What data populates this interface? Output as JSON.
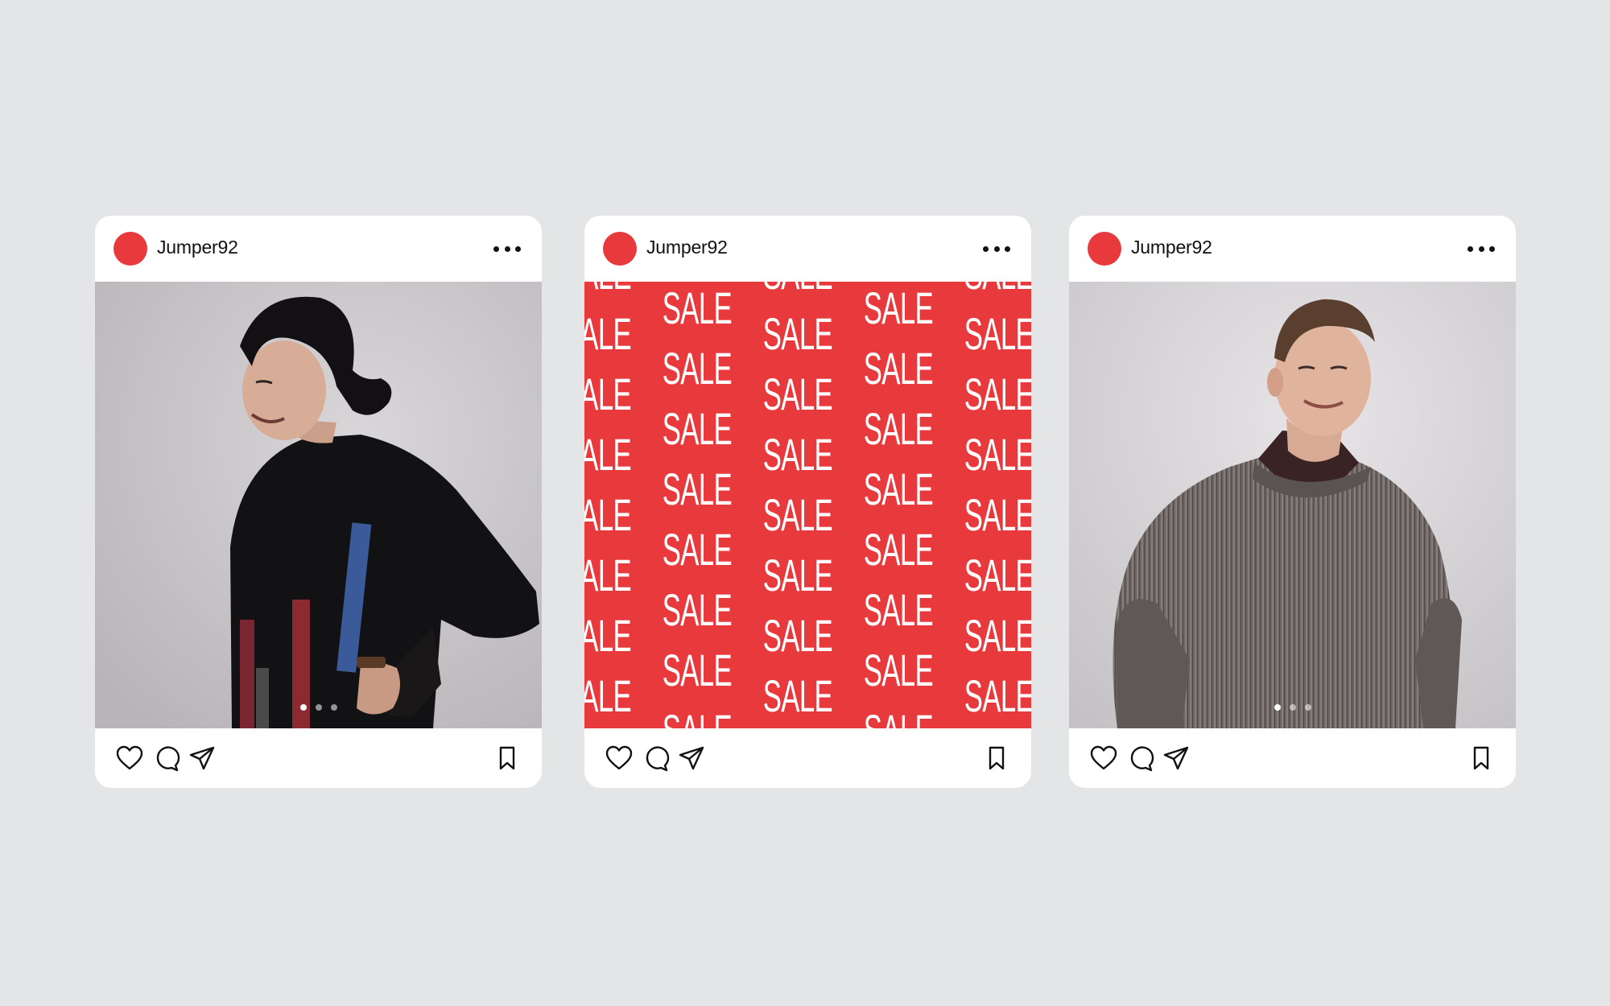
{
  "posts": [
    {
      "username": "Jumper92",
      "media_kind": "photo",
      "subject": "smiling woman in black jumper with red and blue stripes",
      "carousel": {
        "count": 3,
        "active": 0
      }
    },
    {
      "username": "Jumper92",
      "media_kind": "pattern",
      "pattern_word": "SALE",
      "carousel": null
    },
    {
      "username": "Jumper92",
      "media_kind": "photo",
      "subject": "smiling young man in grey knit jumper",
      "carousel": {
        "count": 3,
        "active": 0
      }
    }
  ],
  "icons": [
    "heart-icon",
    "comment-icon",
    "share-icon",
    "bookmark-icon",
    "more-icon"
  ],
  "colors": {
    "accent": "#e8393c",
    "background": "#e4e5e7",
    "card": "#ffffff"
  }
}
